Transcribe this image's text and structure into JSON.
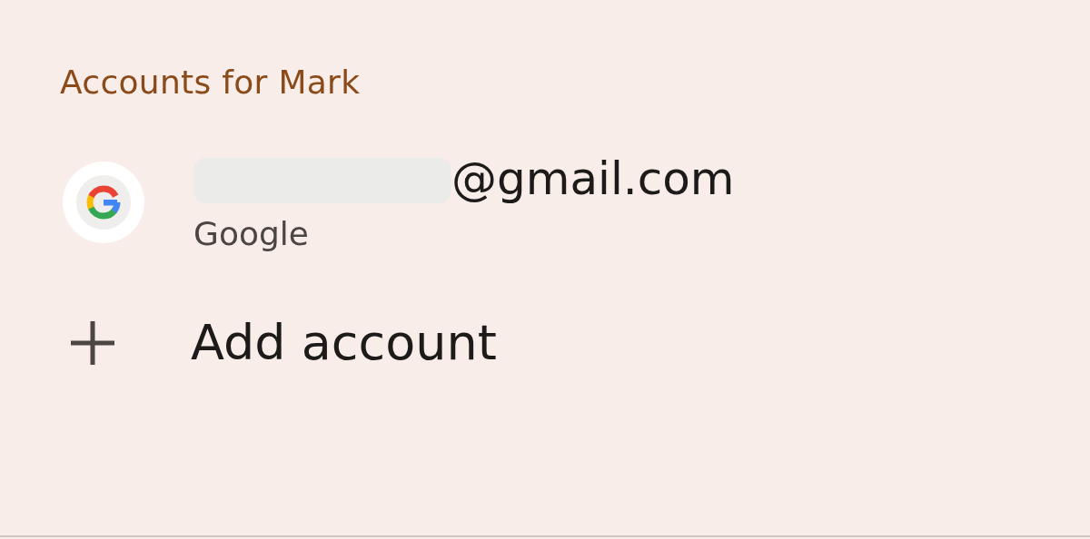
{
  "header": {
    "title": "Accounts for Mark"
  },
  "accounts": [
    {
      "email": "@gmail.com",
      "redacted": true,
      "provider": "Google"
    }
  ],
  "add_account": {
    "label": "Add account"
  }
}
